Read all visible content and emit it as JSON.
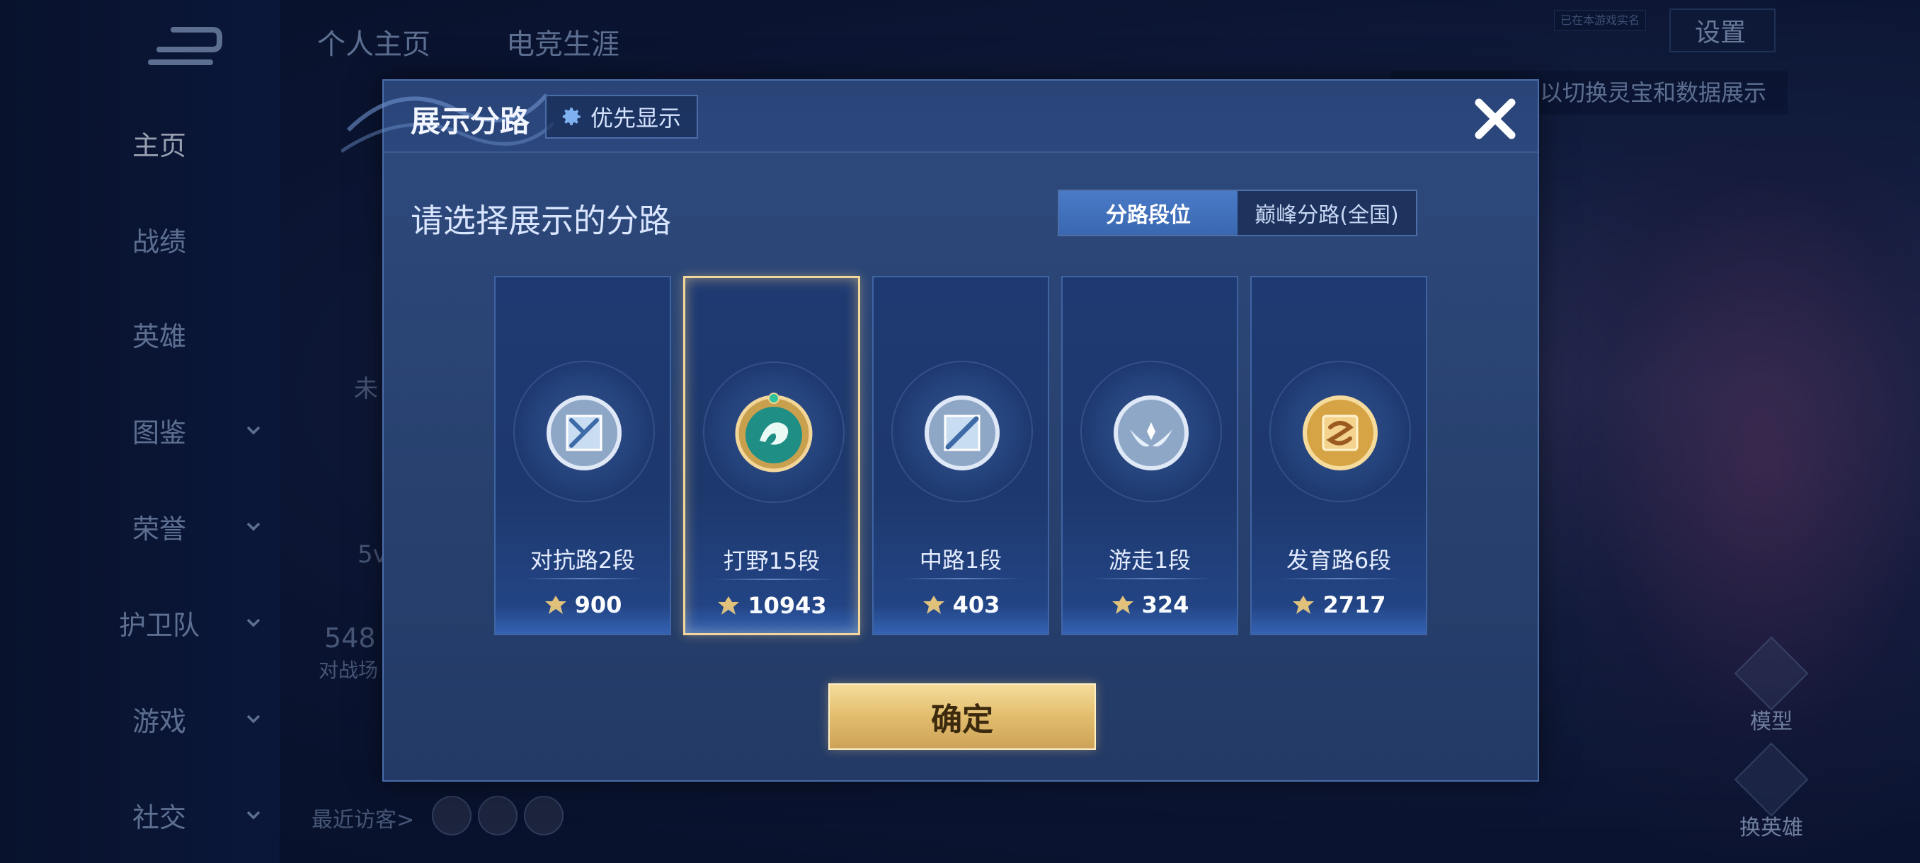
{
  "background": {
    "top_tabs": [
      "个人主页",
      "电竞生涯"
    ],
    "sidebar": [
      {
        "label": "主页",
        "active": true,
        "has_chevron": false
      },
      {
        "label": "战绩",
        "active": false,
        "has_chevron": false
      },
      {
        "label": "英雄",
        "active": false,
        "has_chevron": false
      },
      {
        "label": "图鉴",
        "active": false,
        "has_chevron": true
      },
      {
        "label": "荣誉",
        "active": false,
        "has_chevron": true
      },
      {
        "label": "护卫队",
        "active": false,
        "has_chevron": true
      },
      {
        "label": "游戏",
        "active": false,
        "has_chevron": true
      },
      {
        "label": "社交",
        "active": false,
        "has_chevron": true
      }
    ],
    "settings_label": "设置",
    "status_chip": "已在本游戏实名",
    "hint_text": "以切换灵宝和数据展示",
    "visitors_label": "最近访客>",
    "partial_texts": {
      "t1": "未",
      "t2": "5v",
      "t3": "548",
      "t4": "对战场"
    },
    "side_actions": {
      "model": "模型",
      "change_hero": "换英雄"
    }
  },
  "modal": {
    "title": "展示分路",
    "priority_label": "优先显示",
    "subtitle": "请选择展示的分路",
    "segments": [
      {
        "label": "分路段位",
        "active": true
      },
      {
        "label": "巅峰分路(全国)",
        "active": false
      }
    ],
    "lanes": [
      {
        "name": "对抗路2段",
        "score": "900",
        "selected": false,
        "emblem": "clash-lane-emblem",
        "tier": "silver"
      },
      {
        "name": "打野15段",
        "score": "10943",
        "selected": true,
        "emblem": "jungle-dragon-emblem",
        "tier": "jade-gold"
      },
      {
        "name": "中路1段",
        "score": "403",
        "selected": false,
        "emblem": "mid-lane-emblem",
        "tier": "silver"
      },
      {
        "name": "游走1段",
        "score": "324",
        "selected": false,
        "emblem": "roam-wings-emblem",
        "tier": "silver"
      },
      {
        "name": "发育路6段",
        "score": "2717",
        "selected": false,
        "emblem": "farm-lane-emblem",
        "tier": "gold"
      }
    ],
    "confirm_label": "确定"
  },
  "colors": {
    "modal_bg": "#2b467a",
    "selected_border": "#f3d79a",
    "segment_active": "#4a7bc8",
    "confirm_gold": "#e2bd6e"
  }
}
